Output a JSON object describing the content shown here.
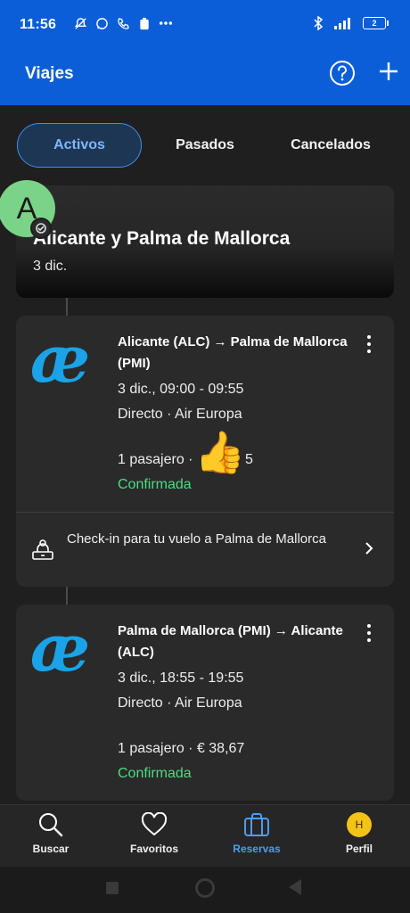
{
  "status_bar": {
    "time": "11:56",
    "battery": "2"
  },
  "app_bar": {
    "title": "Viajes"
  },
  "tabs": [
    {
      "label": "Activos",
      "active": true
    },
    {
      "label": "Pasados",
      "active": false
    },
    {
      "label": "Cancelados",
      "active": false
    }
  ],
  "trip": {
    "avatar_letter": "A",
    "title": "Alicante y Palma de Mallorca",
    "date": "3 dic."
  },
  "flights": [
    {
      "route": "Alicante (ALC) → Palma de Mallorca (PMI)",
      "time": "3 dic., 09:00 - 09:55",
      "details": "Directo · Air Europa",
      "passengers": "1 pasajero · € 38,67",
      "passengers_visible": "1 pasajero ·",
      "passengers_tail": "5",
      "status": "Confirmada",
      "checkin": "Check-in para tu vuelo a Palma de Mallorca"
    },
    {
      "route": "Palma de Mallorca (PMI) → Alicante (ALC)",
      "time": "3 dic., 18:55 - 19:55",
      "details": "Directo · Air Europa",
      "passengers": "1 pasajero · € 38,67",
      "status": "Confirmada"
    }
  ],
  "bottom_nav": [
    {
      "label": "Buscar",
      "icon": "search-icon"
    },
    {
      "label": "Favoritos",
      "icon": "heart-icon"
    },
    {
      "label": "Reservas",
      "icon": "briefcase-icon",
      "active": true
    },
    {
      "label": "Perfil",
      "icon": "profile-icon",
      "initial": "H"
    }
  ],
  "overlay_emoji": "👍",
  "colors": {
    "primary": "#0b5ed7",
    "accent": "#4d9df2",
    "confirmed": "#4ade80",
    "airline_logo": "#1aa3e8"
  }
}
